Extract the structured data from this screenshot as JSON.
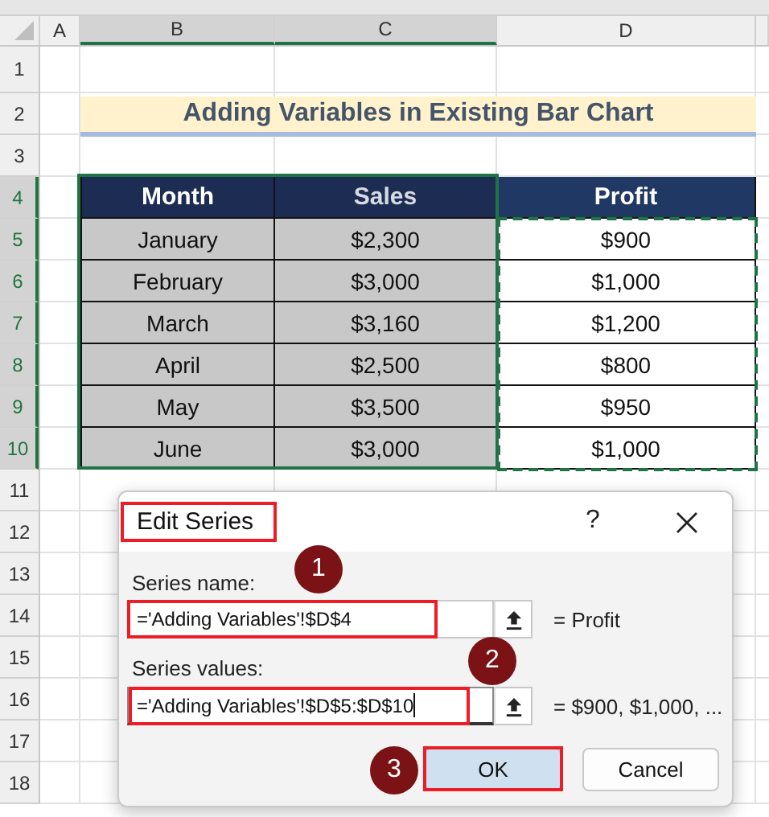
{
  "column_headers": [
    {
      "label": "A",
      "selected": false
    },
    {
      "label": "B",
      "selected": true
    },
    {
      "label": "C",
      "selected": true
    },
    {
      "label": "D",
      "selected": false
    }
  ],
  "row_headers": [
    {
      "label": "1",
      "selected": false
    },
    {
      "label": "2",
      "selected": false
    },
    {
      "label": "3",
      "selected": false
    },
    {
      "label": "4",
      "selected": true
    },
    {
      "label": "5",
      "selected": true
    },
    {
      "label": "6",
      "selected": true
    },
    {
      "label": "7",
      "selected": true
    },
    {
      "label": "8",
      "selected": true
    },
    {
      "label": "9",
      "selected": true
    },
    {
      "label": "10",
      "selected": true
    },
    {
      "label": "11",
      "selected": false
    },
    {
      "label": "12",
      "selected": false
    },
    {
      "label": "13",
      "selected": false
    },
    {
      "label": "14",
      "selected": false
    },
    {
      "label": "15",
      "selected": false
    },
    {
      "label": "16",
      "selected": false
    },
    {
      "label": "17",
      "selected": false
    },
    {
      "label": "18",
      "selected": false
    }
  ],
  "sheet_title": "Adding Variables in Existing Bar Chart",
  "table": {
    "copy_marquee": true,
    "columns": [
      {
        "label": "Month",
        "selected": true
      },
      {
        "label": "Sales",
        "selected": true
      },
      {
        "label": "Profit",
        "selected": false
      }
    ],
    "rows": [
      [
        "January",
        "$2,300",
        "$900"
      ],
      [
        "February",
        "$3,000",
        "$1,000"
      ],
      [
        "March",
        "$3,160",
        "$1,200"
      ],
      [
        "April",
        "$2,500",
        "$800"
      ],
      [
        "May",
        "$3,500",
        "$950"
      ],
      [
        "June",
        "$3,000",
        "$1,000"
      ]
    ]
  },
  "dialog": {
    "title": "Edit Series",
    "help": "?",
    "fields": [
      {
        "label": "Series name:",
        "value": "='Adding Variables'!$D$4",
        "reading": "= Profit",
        "focused": false
      },
      {
        "label": "Series values:",
        "value": "='Adding Variables'!$D$5:$D$10",
        "reading": "= $900, $1,000, ...",
        "focused": true
      }
    ],
    "buttons": [
      {
        "label": "OK",
        "default": true
      },
      {
        "label": "Cancel",
        "default": false
      }
    ]
  },
  "callouts": [
    {
      "number": "1"
    },
    {
      "number": "2"
    },
    {
      "number": "3"
    }
  ]
}
